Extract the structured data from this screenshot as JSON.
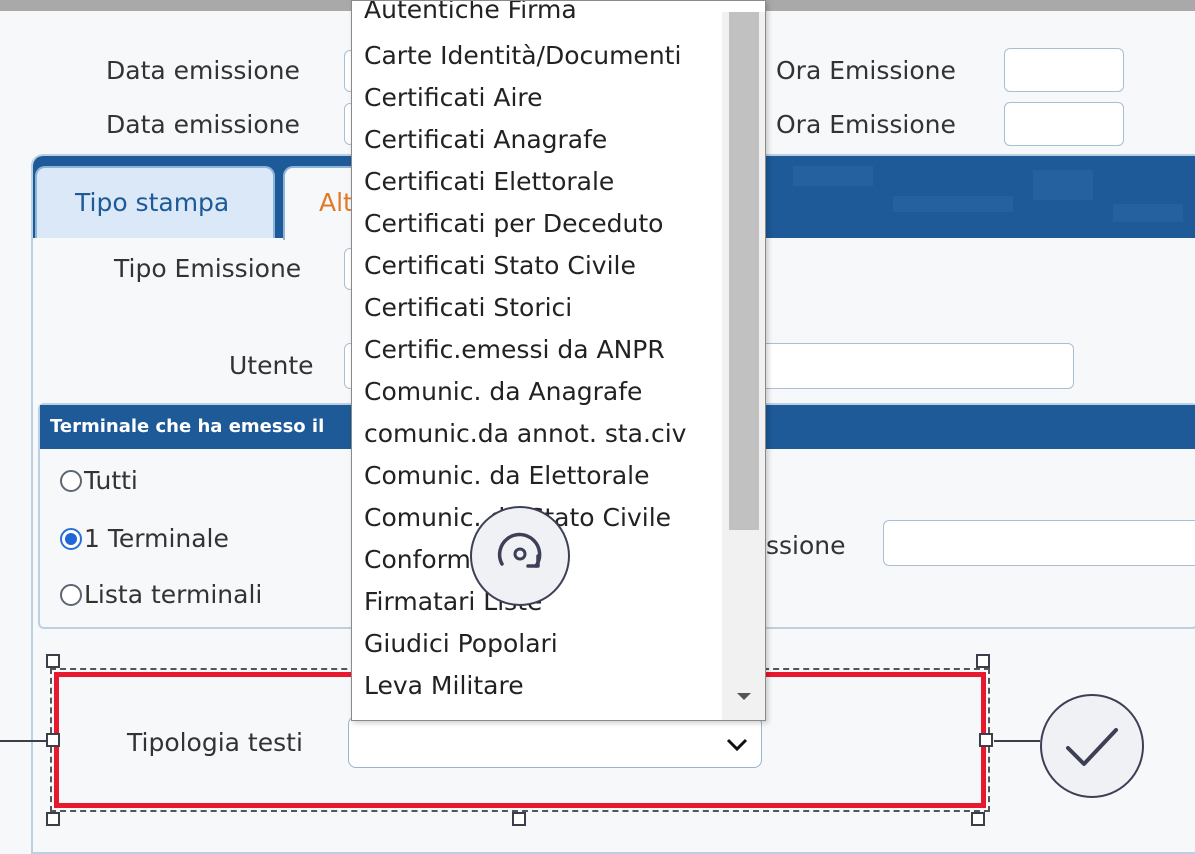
{
  "form": {
    "data_emissione_1": "Data emissione",
    "data_emissione_2": "Data emissione",
    "ora_emissione_1": "Ora Emissione",
    "ora_emissione_2": "Ora Emissione",
    "tipo_emissione": "Tipo Emissione",
    "utente": "Utente",
    "emissione_partial": "ssione",
    "tipologia_testi": "Tipologia testi"
  },
  "tabs": [
    {
      "label": "Tipo stampa"
    },
    {
      "label": "Alt"
    }
  ],
  "terminal_group": {
    "header": "Terminale che ha emesso il",
    "options": [
      {
        "label": "Tutti",
        "selected": false
      },
      {
        "label": "1 Terminale",
        "selected": true
      },
      {
        "label": "Lista terminali",
        "selected": false
      }
    ]
  },
  "dropdown": {
    "items": [
      "Autentiche Firma",
      "Carte Identità/Documenti",
      "Certificati Aire",
      "Certificati Anagrafe",
      "Certificati Elettorale",
      "Certificati per Deceduto",
      "Certificati Stato Civile",
      "Certificati Storici",
      "Certific.emessi da ANPR",
      "Comunic. da Anagrafe",
      "comunic.da annot. sta.civ",
      "Comunic. da Elettorale",
      "Comunic. da Stato Civile",
      "Conformi Copie",
      "Firmatari Liste",
      "Giudici Popolari",
      "Leva Militare"
    ]
  },
  "colors": {
    "accent": "#1d5a97",
    "selection": "#e8182e",
    "active_tab_text": "#e07a27"
  },
  "icons": {
    "rotate": "rotate-icon",
    "confirm": "check-icon",
    "chevron": "chevron-down-icon"
  }
}
